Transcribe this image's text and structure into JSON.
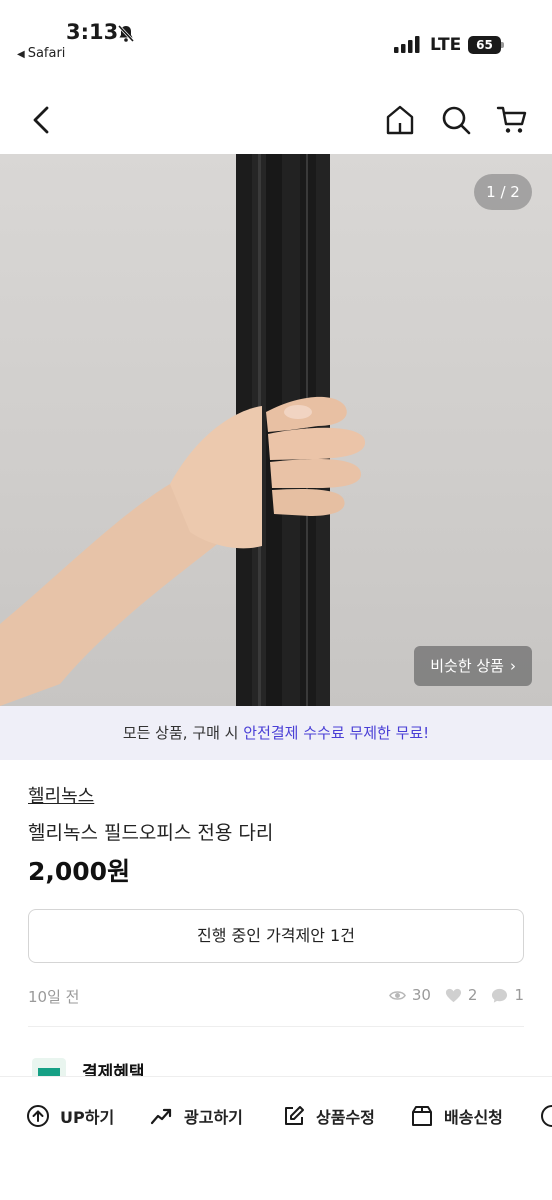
{
  "status_bar": {
    "time": "3:13",
    "back_app": "Safari",
    "network": "LTE",
    "battery": "65"
  },
  "hero": {
    "page_counter": "1 / 2",
    "similar_label": "비슷한 상품"
  },
  "banner": {
    "prefix": "모든 상품, 구매 시 ",
    "highlight": "안전결제 수수료 무제한 무료!"
  },
  "product": {
    "shop_name": "헬리녹스",
    "title": "헬리녹스 필드오피스 전용 다리",
    "price": "2,000원",
    "offer_label": "진행 중인 가격제안 1건",
    "posted": "10일 전",
    "views": "30",
    "likes": "2",
    "chats": "1"
  },
  "benefit": {
    "title": "결제혜택"
  },
  "bottom_bar": {
    "up_label": "UP하기",
    "ad_label": "광고하기",
    "edit_label": "상품수정",
    "ship_label": "배송신청"
  },
  "icons": {
    "status": [
      "bell-slash-icon",
      "signal-icon"
    ],
    "nav": [
      "back-icon",
      "home-icon",
      "search-icon",
      "cart-icon"
    ],
    "stats": [
      "eye-icon",
      "heart-icon",
      "chat-icon"
    ],
    "bottom": [
      "up-arrow-icon",
      "chart-trend-icon",
      "edit-icon",
      "box-icon",
      "more-icon"
    ]
  }
}
